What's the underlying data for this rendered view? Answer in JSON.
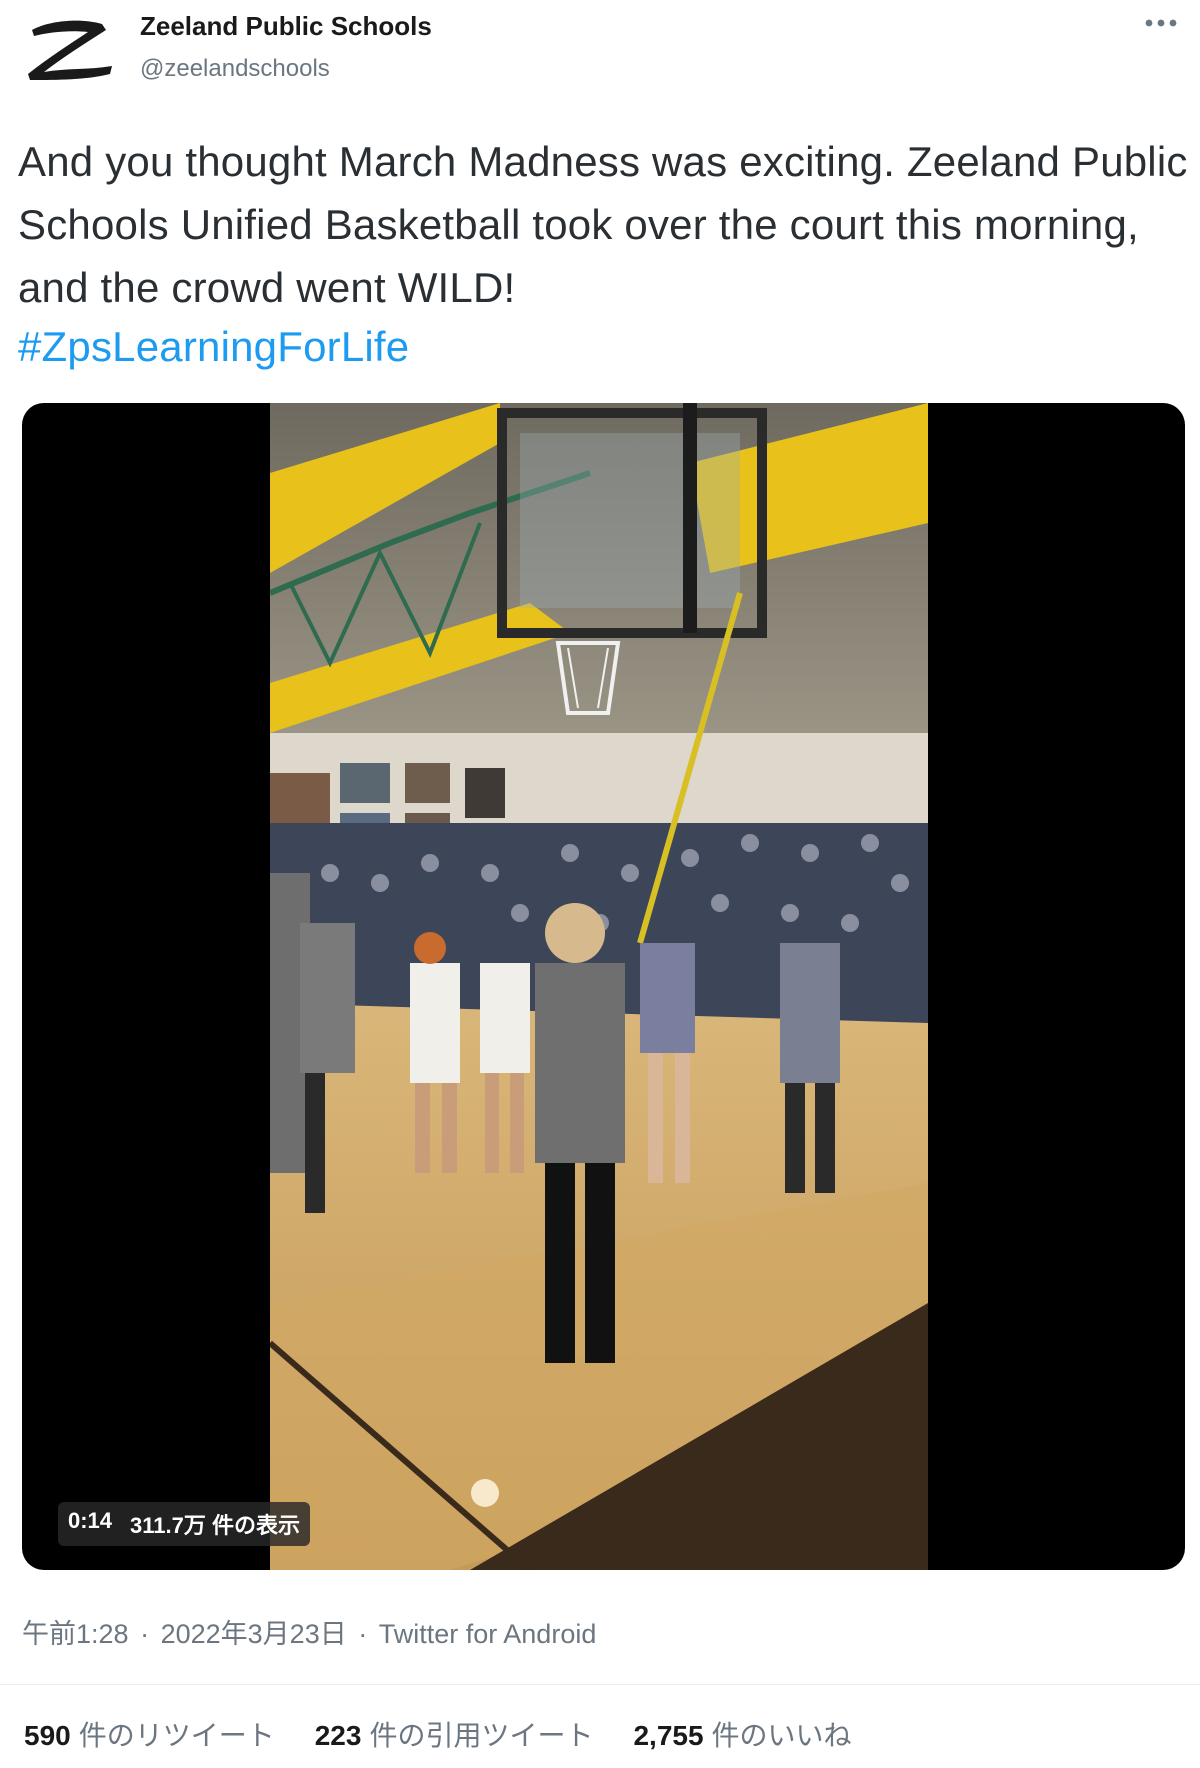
{
  "author": {
    "name": "Zeeland Public Schools",
    "handle": "@zeelandschools",
    "avatar_icon": "zeeland-z-logo-icon"
  },
  "more_icon": "more-dots-icon",
  "tweet": {
    "text": "And you thought March Madness was exciting. Zeeland Public Schools Unified Basketball took over the court this morning, and the crowd went WILD!",
    "hashtag": "#ZpsLearningForLife"
  },
  "video": {
    "duration": "0:14",
    "views": "311.7万 件の表示"
  },
  "meta": {
    "time": "午前1:28",
    "date": "2022年3月23日",
    "source": "Twitter for Android",
    "separator": "·"
  },
  "stats": {
    "retweets": {
      "count": "590",
      "label": "件のリツイート"
    },
    "quotes": {
      "count": "223",
      "label": "件の引用ツイート"
    },
    "likes": {
      "count": "2,755",
      "label": "件のいいね"
    }
  },
  "colors": {
    "link": "#1d9bf0",
    "secondary_text": "#6b7680",
    "media_bg": "#000000"
  }
}
